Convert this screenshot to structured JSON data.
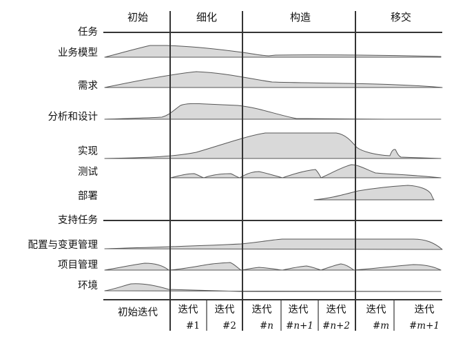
{
  "phases": [
    "初始",
    "细化",
    "构造",
    "移交"
  ],
  "rows": {
    "tasks_header": "任务",
    "business_modeling": "业务模型",
    "requirements": "需求",
    "analysis_design": "分析和设计",
    "implementation": "实现",
    "test": "测试",
    "deployment": "部署",
    "support_header": "支持任务",
    "config_change": "配置与变更管理",
    "project_mgmt": "项目管理",
    "environment": "环境"
  },
  "iterations": [
    {
      "label": "初始迭代",
      "num": ""
    },
    {
      "label": "迭代",
      "num": "#1"
    },
    {
      "label": "迭代",
      "num": "#2"
    },
    {
      "label": "迭代",
      "num": "#n"
    },
    {
      "label": "迭代",
      "num": "#n+1"
    },
    {
      "label": "迭代",
      "num": "#n+2"
    },
    {
      "label": "迭代",
      "num": "#m"
    },
    {
      "label": "迭代",
      "num": "#m+1"
    }
  ],
  "colors": {
    "fill": "#d9d9d9",
    "stroke": "#555555",
    "line": "#333333"
  }
}
